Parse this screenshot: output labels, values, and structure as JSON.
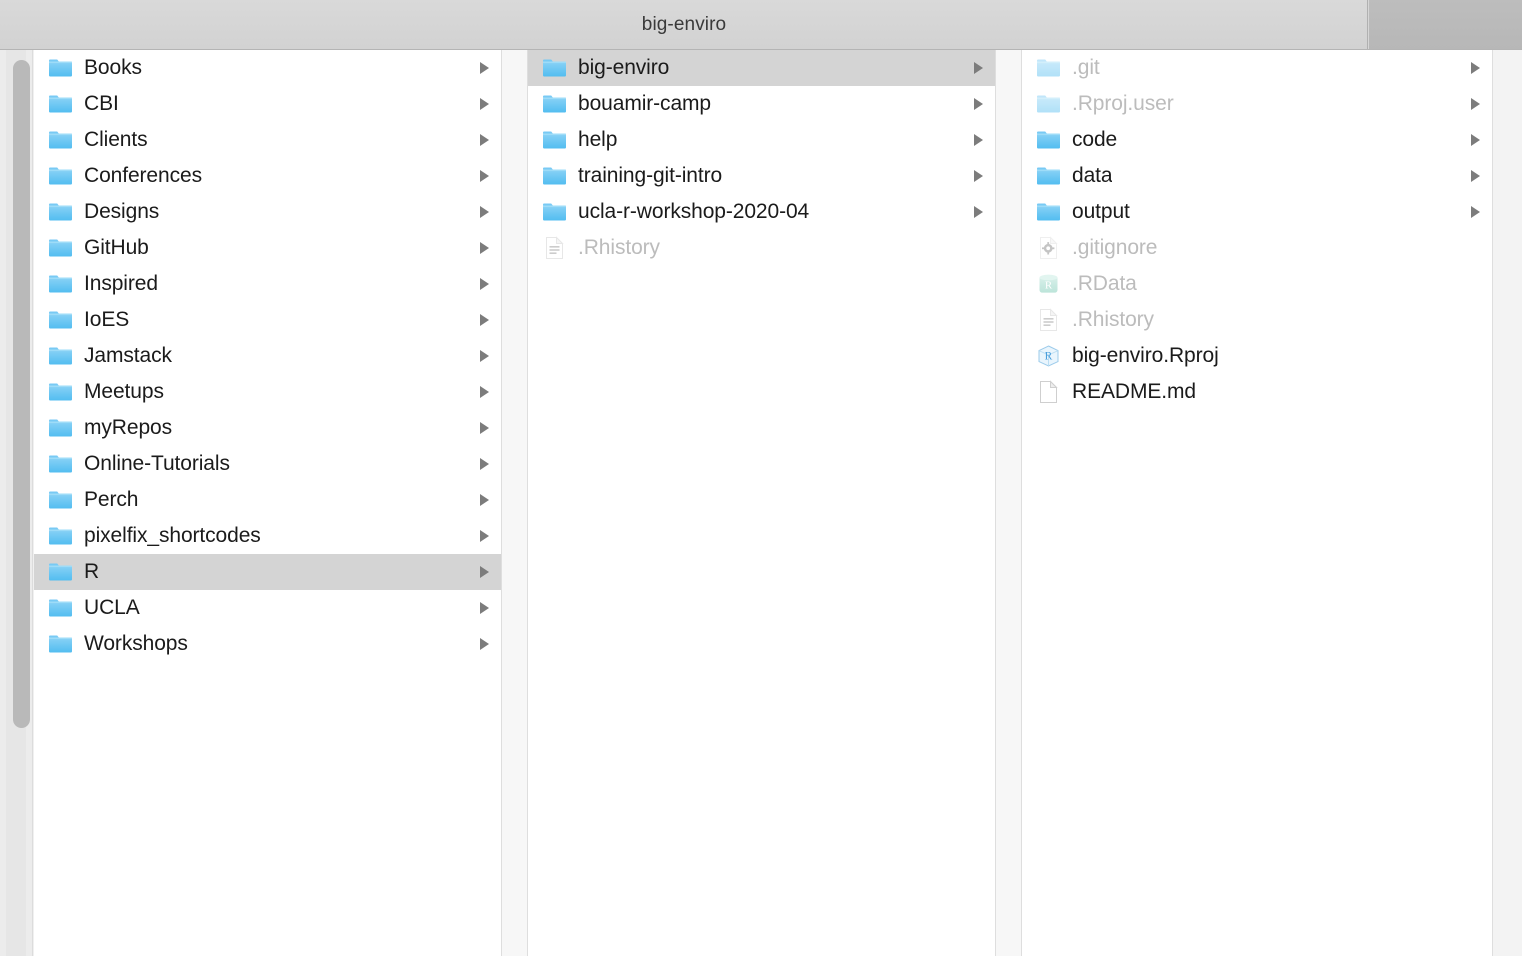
{
  "window": {
    "title": "big-enviro"
  },
  "colors": {
    "folder_blue": "#62c3f2",
    "folder_blue_light": "#8fd5f7",
    "selection_gray": "#d4d4d4",
    "titlebar_gray": "#d6d6d6",
    "titlebar_inactive_gray": "#bdbdbd",
    "text_primary": "#1b1b1b",
    "text_dim": "#bcbcbc",
    "chevron_gray": "#7c7c7c",
    "rdata_teal": "#8fd3c4",
    "rproj_blue": "#7fb8e8"
  },
  "columns": [
    {
      "name": "column-1",
      "items": [
        {
          "label": "Books",
          "icon": "folder-icon",
          "kind": "folder",
          "chevron": true,
          "selected": false,
          "dim": false
        },
        {
          "label": "CBI",
          "icon": "folder-icon",
          "kind": "folder",
          "chevron": true,
          "selected": false,
          "dim": false
        },
        {
          "label": "Clients",
          "icon": "folder-icon",
          "kind": "folder",
          "chevron": true,
          "selected": false,
          "dim": false
        },
        {
          "label": "Conferences",
          "icon": "folder-icon",
          "kind": "folder",
          "chevron": true,
          "selected": false,
          "dim": false
        },
        {
          "label": "Designs",
          "icon": "folder-icon",
          "kind": "folder",
          "chevron": true,
          "selected": false,
          "dim": false
        },
        {
          "label": "GitHub",
          "icon": "folder-icon",
          "kind": "folder",
          "chevron": true,
          "selected": false,
          "dim": false
        },
        {
          "label": "Inspired",
          "icon": "folder-icon",
          "kind": "folder",
          "chevron": true,
          "selected": false,
          "dim": false
        },
        {
          "label": "IoES",
          "icon": "folder-icon",
          "kind": "folder",
          "chevron": true,
          "selected": false,
          "dim": false
        },
        {
          "label": "Jamstack",
          "icon": "folder-icon",
          "kind": "folder",
          "chevron": true,
          "selected": false,
          "dim": false
        },
        {
          "label": "Meetups",
          "icon": "folder-icon",
          "kind": "folder",
          "chevron": true,
          "selected": false,
          "dim": false
        },
        {
          "label": "myRepos",
          "icon": "folder-icon",
          "kind": "folder",
          "chevron": true,
          "selected": false,
          "dim": false
        },
        {
          "label": "Online-Tutorials",
          "icon": "folder-icon",
          "kind": "folder",
          "chevron": true,
          "selected": false,
          "dim": false
        },
        {
          "label": "Perch",
          "icon": "folder-icon",
          "kind": "folder",
          "chevron": true,
          "selected": false,
          "dim": false
        },
        {
          "label": "pixelfix_shortcodes",
          "icon": "folder-icon",
          "kind": "folder",
          "chevron": true,
          "selected": false,
          "dim": false
        },
        {
          "label": "R",
          "icon": "folder-icon",
          "kind": "folder",
          "chevron": true,
          "selected": true,
          "dim": false
        },
        {
          "label": "UCLA",
          "icon": "folder-icon",
          "kind": "folder",
          "chevron": true,
          "selected": false,
          "dim": false
        },
        {
          "label": "Workshops",
          "icon": "folder-icon",
          "kind": "folder",
          "chevron": true,
          "selected": false,
          "dim": false
        }
      ]
    },
    {
      "name": "column-2",
      "items": [
        {
          "label": "big-enviro",
          "icon": "folder-icon",
          "kind": "folder",
          "chevron": true,
          "selected": true,
          "dim": false
        },
        {
          "label": "bouamir-camp",
          "icon": "folder-icon",
          "kind": "folder",
          "chevron": true,
          "selected": false,
          "dim": false
        },
        {
          "label": "help",
          "icon": "folder-icon",
          "kind": "folder",
          "chevron": true,
          "selected": false,
          "dim": false
        },
        {
          "label": "training-git-intro",
          "icon": "folder-icon",
          "kind": "folder",
          "chevron": true,
          "selected": false,
          "dim": false
        },
        {
          "label": "ucla-r-workshop-2020-04",
          "icon": "folder-icon",
          "kind": "folder",
          "chevron": true,
          "selected": false,
          "dim": false
        },
        {
          "label": ".Rhistory",
          "icon": "text-document-icon",
          "kind": "file",
          "chevron": false,
          "selected": false,
          "dim": true
        }
      ]
    },
    {
      "name": "column-3",
      "items": [
        {
          "label": ".git",
          "icon": "folder-icon",
          "kind": "folder",
          "chevron": true,
          "selected": false,
          "dim": true
        },
        {
          "label": ".Rproj.user",
          "icon": "folder-icon",
          "kind": "folder",
          "chevron": true,
          "selected": false,
          "dim": true
        },
        {
          "label": "code",
          "icon": "folder-icon",
          "kind": "folder",
          "chevron": true,
          "selected": false,
          "dim": false
        },
        {
          "label": "data",
          "icon": "folder-icon",
          "kind": "folder",
          "chevron": true,
          "selected": false,
          "dim": false
        },
        {
          "label": "output",
          "icon": "folder-icon",
          "kind": "folder",
          "chevron": true,
          "selected": false,
          "dim": false
        },
        {
          "label": ".gitignore",
          "icon": "gear-document-icon",
          "kind": "file",
          "chevron": false,
          "selected": false,
          "dim": true
        },
        {
          "label": ".RData",
          "icon": "rdata-icon",
          "kind": "file",
          "chevron": false,
          "selected": false,
          "dim": true
        },
        {
          "label": ".Rhistory",
          "icon": "text-document-icon",
          "kind": "file",
          "chevron": false,
          "selected": false,
          "dim": true
        },
        {
          "label": "big-enviro.Rproj",
          "icon": "rproj-icon",
          "kind": "file",
          "chevron": false,
          "selected": false,
          "dim": false
        },
        {
          "label": "README.md",
          "icon": "blank-document-icon",
          "kind": "file",
          "chevron": false,
          "selected": false,
          "dim": false
        }
      ]
    }
  ]
}
